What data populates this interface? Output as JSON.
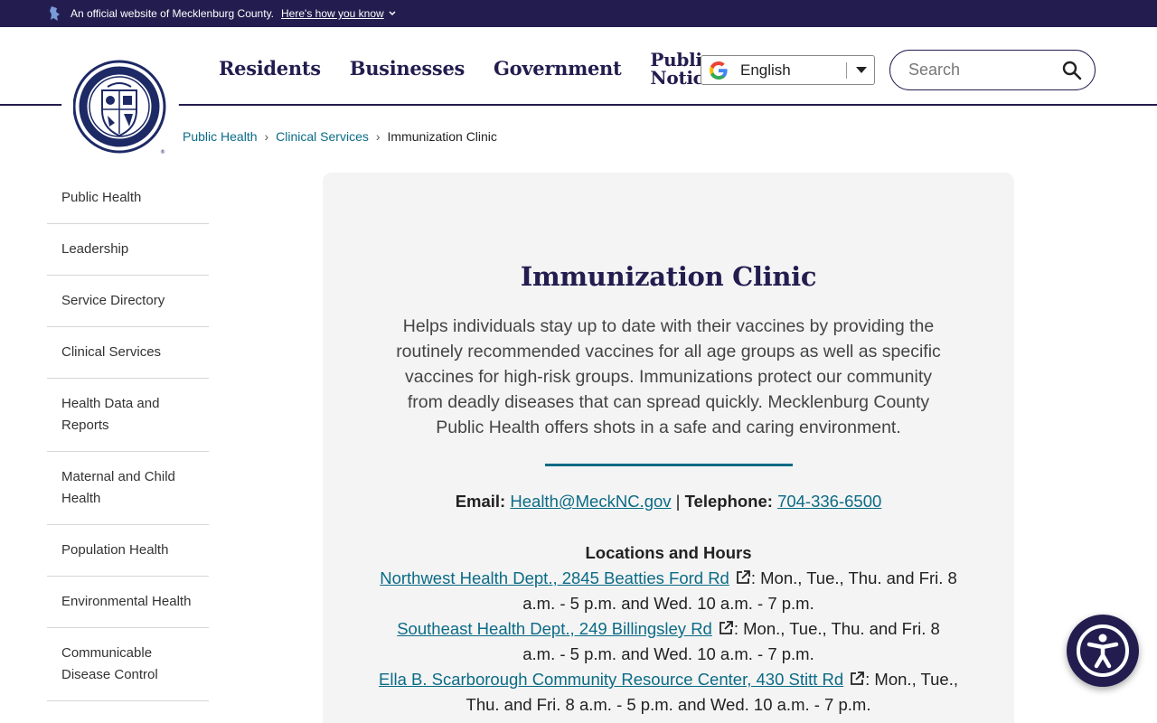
{
  "banner": {
    "official_text": "An official website of Mecklenburg County.",
    "howto_text": "Here's how you know"
  },
  "nav": {
    "items": [
      "Residents",
      "Businesses",
      "Government"
    ],
    "public_notices_line1": "Public",
    "public_notices_line2": "Notices"
  },
  "language": {
    "selected": "English"
  },
  "search": {
    "placeholder": "Search"
  },
  "breadcrumb": {
    "items": [
      "Public Health",
      "Clinical Services"
    ],
    "current": "Immunization Clinic"
  },
  "sidebar": {
    "items": [
      "Public Health",
      "Leadership",
      "Service Directory",
      "Clinical Services",
      "Health Data and Reports",
      "Maternal and Child Health",
      "Population Health",
      "Environmental Health",
      "Communicable Disease Control"
    ]
  },
  "main": {
    "title": "Immunization Clinic",
    "description": "Helps individuals stay up to date with their vaccines by providing the routinely recommended vaccines for all age groups as well as specific vaccines for high-risk groups. Immunizations protect our community from deadly diseases that can spread quickly. Mecklenburg County Public Health offers shots in a safe and caring environment.",
    "email_label": "Email:",
    "email": "Health@MeckNC.gov",
    "separator": "|",
    "phone_label": "Telephone:",
    "phone": "704-336-6500",
    "locations_title": "Locations and Hours",
    "locations": [
      {
        "link": "Northwest Health Dept., 2845 Beatties Ford Rd",
        "hours": ": Mon., Tue., Thu. and Fri. 8 a.m. - 5 p.m. and Wed. 10 a.m. - 7 p.m."
      },
      {
        "link": "Southeast Health Dept., 249 Billingsley Rd",
        "hours": ": Mon., Tue., Thu. and Fri. 8 a.m. - 5 p.m. and Wed. 10 a.m. - 7 p.m."
      },
      {
        "link": "Ella B. Scarborough Community Resource Center, 430 Stitt Rd",
        "hours": ": Mon., Tue., Thu. and Fri. 8 a.m. - 5 p.m. and Wed. 10 a.m. - 7 p.m."
      }
    ]
  },
  "colors": {
    "brand_navy": "#231d4f",
    "link_teal": "#0b6b86",
    "card_bg": "#f4f4f4"
  },
  "icons": {
    "banner": "nc-flag-icon",
    "language": "google-g-icon",
    "search": "search-icon",
    "external": "external-link-icon",
    "accessibility": "accessibility-icon"
  }
}
